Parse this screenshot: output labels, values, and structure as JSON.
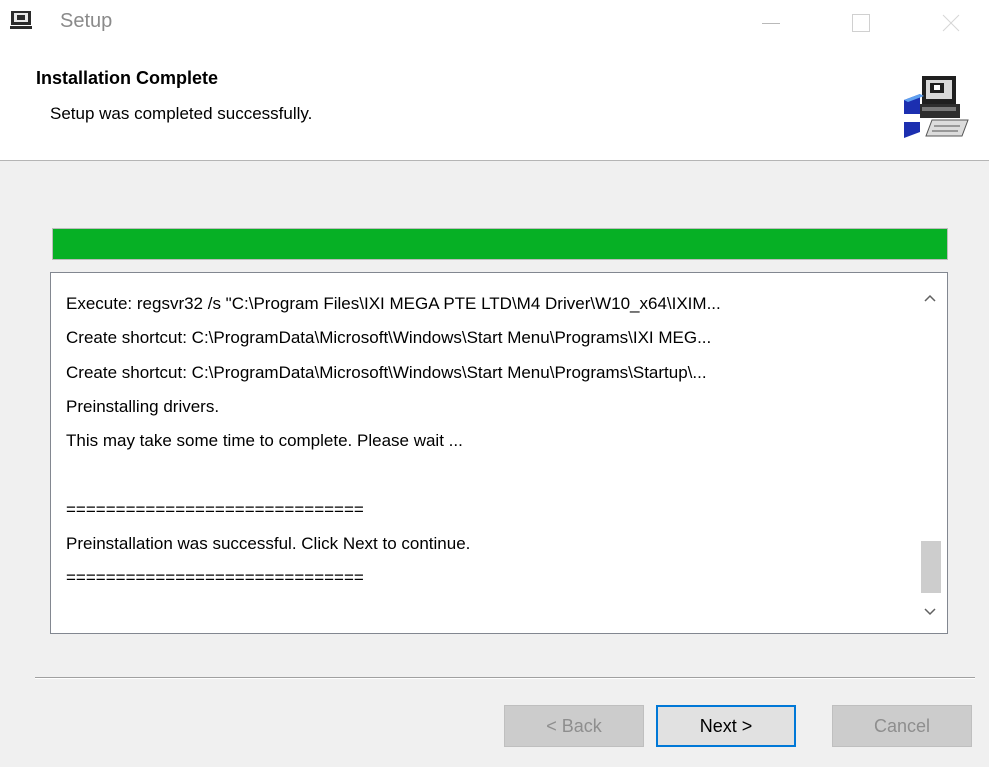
{
  "window": {
    "title": "Setup",
    "icon": "computer-setup-icon",
    "controls": [
      "minimize-icon",
      "maximize-icon",
      "close-icon"
    ]
  },
  "header": {
    "title": "Installation Complete",
    "subtitle": "Setup was completed successfully.",
    "art_icon": "installer-computer-icon"
  },
  "progress": {
    "value_percent": 100,
    "color": "#06b025"
  },
  "log": {
    "lines": [
      "Execute: regsvr32 /s \"C:\\Program Files\\IXI MEGA PTE LTD\\M4 Driver\\W10_x64\\IXIM...",
      "Create shortcut: C:\\ProgramData\\Microsoft\\Windows\\Start Menu\\Programs\\IXI MEG...",
      "Create shortcut: C:\\ProgramData\\Microsoft\\Windows\\Start Menu\\Programs\\Startup\\...",
      "Preinstalling drivers.",
      "This may take some time to complete. Please wait ...",
      "",
      "==============================",
      "Preinstallation was successful. Click Next to continue.",
      "=============================="
    ],
    "scroll_position": "bottom"
  },
  "buttons": {
    "back": "< Back",
    "next": "Next >",
    "cancel": "Cancel"
  },
  "colors": {
    "accent_focus": "#0078d7",
    "progress": "#06b025"
  }
}
